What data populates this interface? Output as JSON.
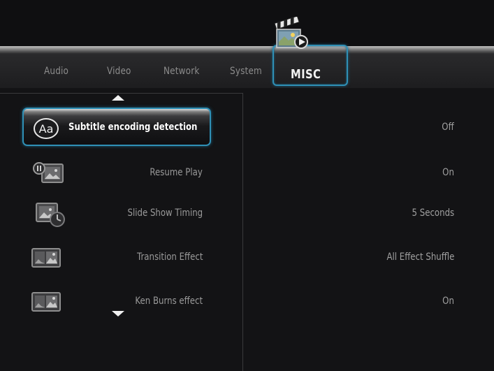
{
  "tabs": {
    "audio": "Audio",
    "video": "Video",
    "network": "Network",
    "system": "System",
    "misc": "MISC"
  },
  "selected_tab": "MISC",
  "settings": [
    {
      "icon": "subtitle-aa-icon",
      "label": "Subtitle encoding detection",
      "value": "Off",
      "selected": true
    },
    {
      "icon": "resume-play-icon",
      "label": "Resume Play",
      "value": "On",
      "selected": false
    },
    {
      "icon": "slide-show-timing-icon",
      "label": "Slide Show Timing",
      "value": "5 Seconds",
      "selected": false
    },
    {
      "icon": "transition-effect-icon",
      "label": "Transition Effect",
      "value": "All Effect Shuffle",
      "selected": false
    },
    {
      "icon": "ken-burns-icon",
      "label": "Ken Burns effect",
      "value": "On",
      "selected": false
    }
  ],
  "colors": {
    "accent": "#2f90b6",
    "background": "#131315",
    "text": "#9a9a9a",
    "selected_text": "#ffffff"
  }
}
